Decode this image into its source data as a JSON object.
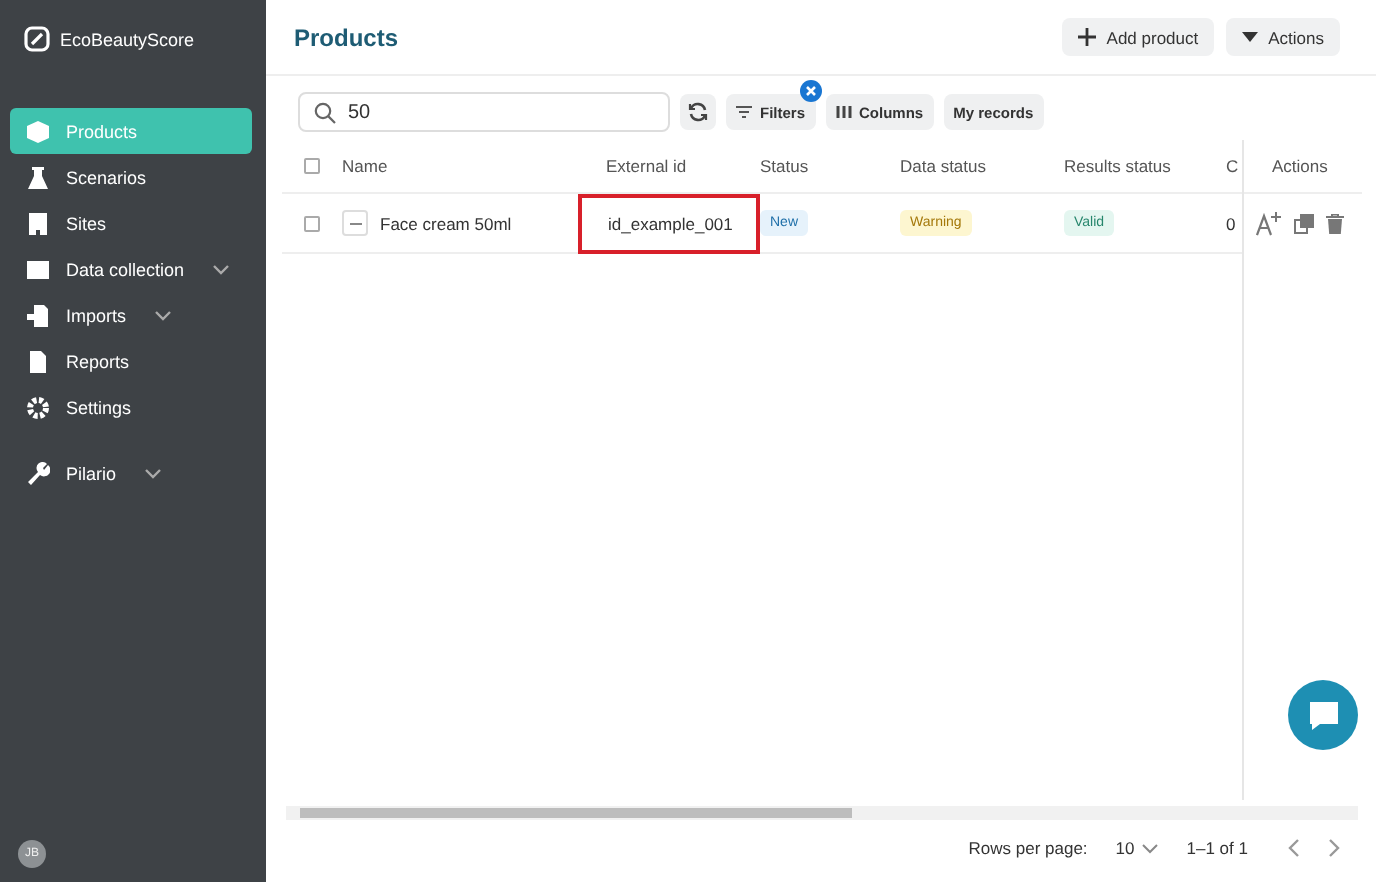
{
  "sidebar": {
    "brand": "EcoBeautyScore",
    "items": [
      {
        "label": "Products",
        "selected": true,
        "expandable": false
      },
      {
        "label": "Scenarios",
        "selected": false,
        "expandable": false
      },
      {
        "label": "Sites",
        "selected": false,
        "expandable": false
      },
      {
        "label": "Data collection",
        "selected": false,
        "expandable": true
      },
      {
        "label": "Imports",
        "selected": false,
        "expandable": true
      },
      {
        "label": "Reports",
        "selected": false,
        "expandable": false
      },
      {
        "label": "Settings",
        "selected": false,
        "expandable": false
      },
      {
        "label": "Pilario",
        "selected": false,
        "expandable": true
      }
    ],
    "avatar": "JB"
  },
  "header": {
    "title": "Products",
    "buttons": [
      "Add product",
      "Actions"
    ]
  },
  "toolbar": {
    "search": "50",
    "buttons": [
      {
        "label": "Filters",
        "active_filter": true
      },
      {
        "label": "Columns",
        "active_filter": false
      },
      {
        "label": "My records",
        "active_filter": false
      }
    ]
  },
  "table": {
    "all_checked": false,
    "columns": [
      "Name",
      "External id",
      "Status",
      "Data status",
      "Results status",
      "C"
    ],
    "actions_heading": "Actions",
    "rows": [
      {
        "checked": false,
        "name": "Face cream 50ml",
        "external_id": "id_example_001",
        "highlighted": true,
        "badges": [
          {
            "label": "New",
            "kind": "info"
          },
          {
            "label": "Warning",
            "kind": "warning"
          },
          {
            "label": "Valid",
            "kind": "success"
          }
        ],
        "column_6": "0"
      }
    ]
  },
  "footer": {
    "rows_label": "Rows per page:",
    "rows_value": "10",
    "range": "1–1 of 1"
  }
}
